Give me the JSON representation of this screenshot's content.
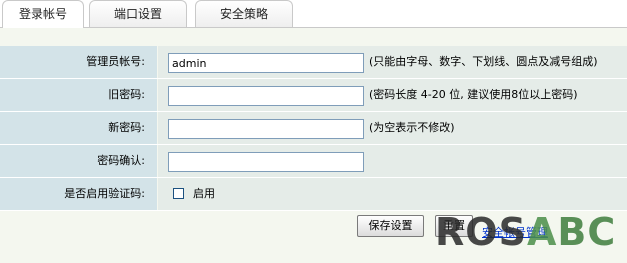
{
  "tabs": [
    {
      "label": "登录帐号",
      "active": true
    },
    {
      "label": "端口设置",
      "active": false
    },
    {
      "label": "安全策略",
      "active": false
    }
  ],
  "form": {
    "admin_account": {
      "label": "管理员帐号:",
      "value": "admin",
      "hint": "(只能由字母、数字、下划线、圆点及减号组成)"
    },
    "old_password": {
      "label": "旧密码:",
      "value": "",
      "hint": "(密码长度  4-20 位, 建议使用8位以上密码)"
    },
    "new_password": {
      "label": "新密码:",
      "value": "",
      "hint": "(为空表示不修改)"
    },
    "confirm_password": {
      "label": "密码确认:",
      "value": ""
    },
    "captcha": {
      "label": "是否启用验证码:",
      "checkbox_label": "启用",
      "checked": false
    }
  },
  "actions": {
    "save_label": "保存设置",
    "reset_label": "重置",
    "link_label": "安全帐号管理"
  },
  "watermark": {
    "text_left": "ROS",
    "text_mid": "A",
    "text_right": "BC"
  }
}
